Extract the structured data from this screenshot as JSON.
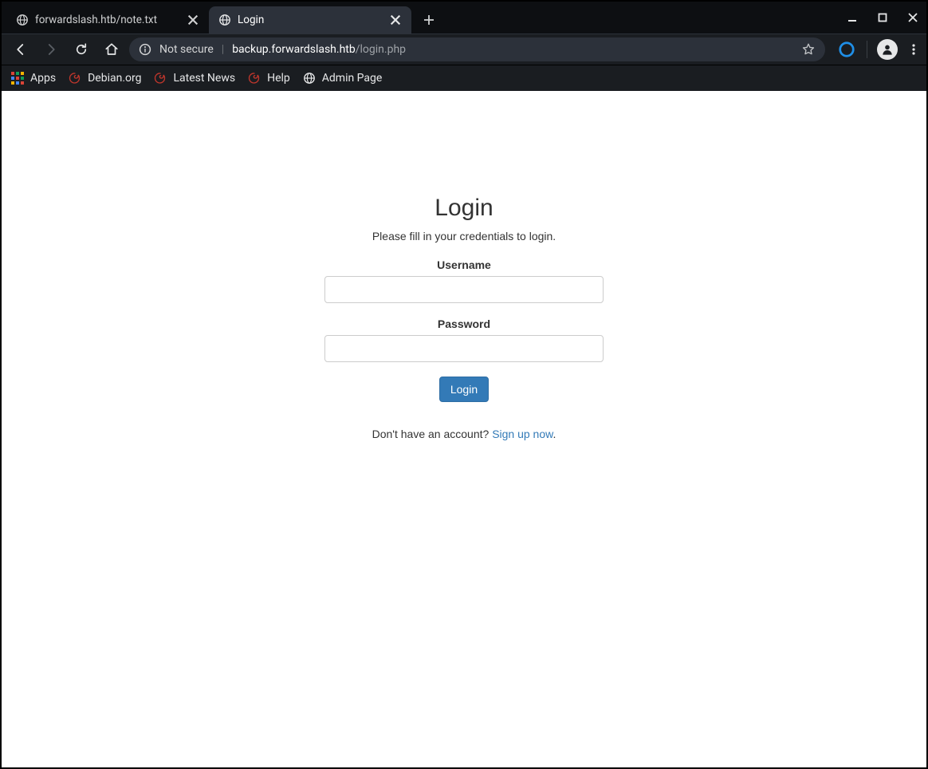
{
  "tabs": [
    {
      "title": "forwardslash.htb/note.txt",
      "active": false
    },
    {
      "title": "Login",
      "active": true
    }
  ],
  "address_bar": {
    "not_secure_label": "Not secure",
    "url_host": "backup.forwardslash.htb",
    "url_path": "/login.php"
  },
  "bookmarks": [
    {
      "label": "Apps",
      "icon": "apps"
    },
    {
      "label": "Debian.org",
      "icon": "swirl"
    },
    {
      "label": "Latest News",
      "icon": "swirl"
    },
    {
      "label": "Help",
      "icon": "swirl"
    },
    {
      "label": "Admin Page",
      "icon": "globe"
    }
  ],
  "page": {
    "heading": "Login",
    "subheading": "Please fill in your credentials to login.",
    "username_label": "Username",
    "password_label": "Password",
    "submit_label": "Login",
    "signup_prompt": "Don't have an account? ",
    "signup_link": "Sign up now",
    "signup_period": "."
  }
}
